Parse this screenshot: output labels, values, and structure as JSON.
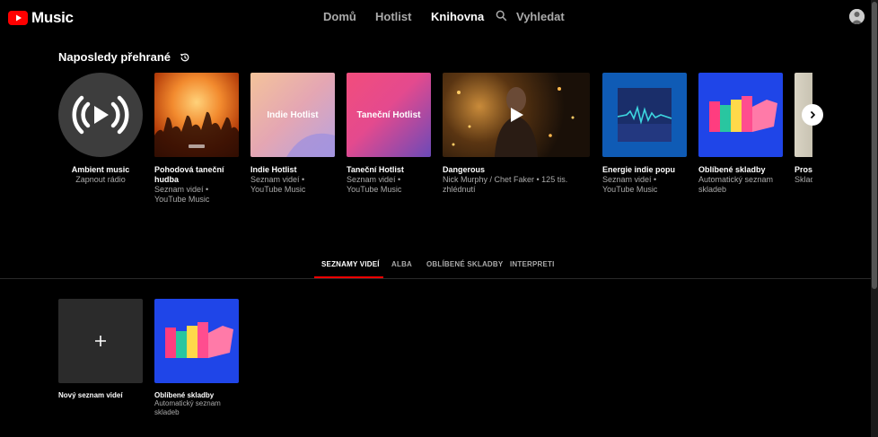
{
  "header": {
    "logo_text": "Music",
    "nav": [
      "Domů",
      "Hotlist",
      "Knihovna"
    ],
    "active_nav": "Knihovna",
    "search_label": "Vyhledat"
  },
  "recent": {
    "title": "Naposledy přehrané",
    "cards": [
      {
        "title": "Ambient music",
        "subtitle": "Zapnout rádio"
      },
      {
        "title": "Pohodová taneční hudba",
        "subtitle": "Seznam videí • YouTube Music"
      },
      {
        "title": "Indie Hotlist",
        "subtitle": "Seznam videí • YouTube Music",
        "overlay": "Indie Hotlist"
      },
      {
        "title": "Taneční Hotlist",
        "subtitle": "Seznam videí • YouTube Music",
        "overlay": "Taneční Hotlist"
      },
      {
        "title": "Dangerous",
        "subtitle": "Nick Murphy / Chet Faker • 125 tis. zhlédnutí"
      },
      {
        "title": "Energie indie popu",
        "subtitle": "Seznam videí • YouTube Music"
      },
      {
        "title": "Oblíbené skladby",
        "subtitle": "Automatický seznam skladeb"
      },
      {
        "title": "Prosp",
        "subtitle": "Sklad Jonn"
      }
    ]
  },
  "tabs": [
    "SEZNAMY VIDEÍ",
    "ALBA",
    "OBLÍBENÉ SKLADBY",
    "INTERPRETI"
  ],
  "active_tab": "SEZNAMY VIDEÍ",
  "playlists": [
    {
      "title": "Nový seznam videí",
      "subtitle": ""
    },
    {
      "title": "Oblíbené skladby",
      "subtitle": "Automatický seznam skladeb"
    }
  ],
  "colors": {
    "accent": "#ff0000",
    "background": "#000000",
    "liked_bg": "#1f45e8"
  }
}
